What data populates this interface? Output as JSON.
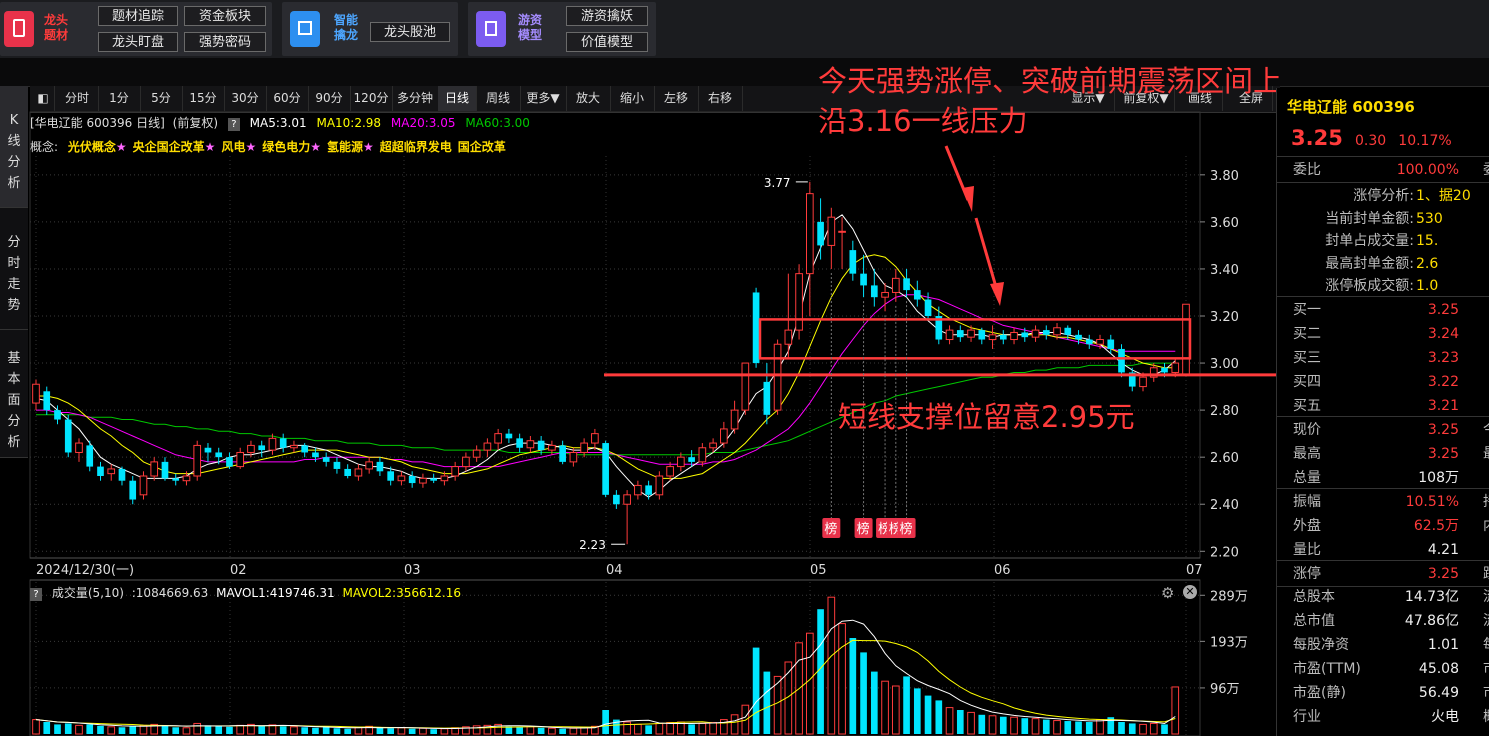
{
  "topbar": {
    "group1_title": "龙头题材",
    "group1_buttons": [
      "题材追踪",
      "资金板块",
      "龙头盯盘",
      "强势密码"
    ],
    "group2_title": "智能擒龙",
    "group2_buttons": [
      "龙头股池"
    ],
    "group3_title": "游资模型",
    "group3_buttons": [
      "游资擒妖",
      "价值模型"
    ]
  },
  "left_tabs": [
    "K线分析",
    "分时走势",
    "基本面分析"
  ],
  "toolbar": {
    "items": [
      "分时",
      "1分",
      "5分",
      "15分",
      "30分",
      "60分",
      "90分",
      "120分",
      "多分钟",
      "日线",
      "周线",
      "更多▼",
      "放大",
      "缩小",
      "左移",
      "右移"
    ],
    "active": "日线",
    "right_items": [
      "显示▼",
      "前复权▼",
      "画线",
      "全屏"
    ]
  },
  "chart_header": {
    "title": "[华电辽能 600396 日线]",
    "adjust": "(前复权)",
    "help": "?",
    "ma5": "MA5:3.01",
    "ma10": "MA10:2.98",
    "ma20": "MA20:3.05",
    "ma60": "MA60:3.00",
    "concept_label": "概念:",
    "concepts": [
      "光伏概念★",
      "央企国企改革★",
      "风电★",
      "绿色电力★",
      "氢能源★",
      "超超临界发电",
      "国企改革"
    ]
  },
  "vol_header": {
    "help": "?",
    "label": "成交量(5,10)",
    "value": ":1084669.63",
    "mavol1": "MAVOL1:419746.31",
    "mavol2": "MAVOL2:356612.16"
  },
  "annotations": {
    "top": [
      "今天强势涨停、突破前期震荡区间上",
      "沿3.16一线压力"
    ],
    "bottom": "短线支撑位留意2.95元"
  },
  "colors": {
    "up": "#ff3b3b",
    "down": "#00e5ff",
    "ma5": "#ffffff",
    "ma10": "#ffff00",
    "ma20": "#ff00ff",
    "ma60": "#00c800",
    "annot": "#ff3b3b"
  },
  "chart_data": {
    "type": "candlestick",
    "price_ticks": [
      "3.80",
      "3.60",
      "3.40",
      "3.20",
      "3.00",
      "2.80",
      "2.60",
      "2.40",
      "2.20"
    ],
    "volume_ticks": [
      "289万",
      "193万",
      "96万"
    ],
    "date_labels": [
      "2024/12/30(一)",
      "02",
      "03",
      "04",
      "05",
      "06",
      "07"
    ],
    "high_label": "3.77",
    "low_label": "2.23",
    "bang_labels": [
      "榜",
      "榜",
      "榜",
      "榜",
      "榜"
    ],
    "ylim": [
      2.18,
      3.88
    ],
    "resistance": 3.16,
    "support": 2.95,
    "candles": [
      [
        2.83,
        2.91,
        2.8,
        2.93
      ],
      [
        2.88,
        2.8,
        2.78,
        2.9
      ],
      [
        2.8,
        2.76,
        2.74,
        2.82
      ],
      [
        2.76,
        2.62,
        2.6,
        2.78
      ],
      [
        2.62,
        2.66,
        2.58,
        2.68
      ],
      [
        2.65,
        2.56,
        2.54,
        2.67
      ],
      [
        2.56,
        2.52,
        2.5,
        2.58
      ],
      [
        2.53,
        2.55,
        2.5,
        2.57
      ],
      [
        2.55,
        2.5,
        2.48,
        2.56
      ],
      [
        2.5,
        2.42,
        2.4,
        2.52
      ],
      [
        2.44,
        2.52,
        2.42,
        2.54
      ],
      [
        2.52,
        2.58,
        2.5,
        2.6
      ],
      [
        2.58,
        2.51,
        2.5,
        2.6
      ],
      [
        2.51,
        2.5,
        2.48,
        2.53
      ],
      [
        2.5,
        2.52,
        2.48,
        2.54
      ],
      [
        2.52,
        2.65,
        2.5,
        2.67
      ],
      [
        2.64,
        2.62,
        2.58,
        2.66
      ],
      [
        2.62,
        2.6,
        2.57,
        2.64
      ],
      [
        2.6,
        2.56,
        2.55,
        2.62
      ],
      [
        2.56,
        2.62,
        2.55,
        2.64
      ],
      [
        2.62,
        2.65,
        2.6,
        2.67
      ],
      [
        2.65,
        2.63,
        2.6,
        2.67
      ],
      [
        2.63,
        2.68,
        2.61,
        2.7
      ],
      [
        2.68,
        2.64,
        2.62,
        2.7
      ],
      [
        2.64,
        2.65,
        2.62,
        2.67
      ],
      [
        2.65,
        2.62,
        2.6,
        2.66
      ],
      [
        2.62,
        2.6,
        2.58,
        2.64
      ],
      [
        2.6,
        2.58,
        2.56,
        2.62
      ],
      [
        2.58,
        2.55,
        2.53,
        2.6
      ],
      [
        2.55,
        2.52,
        2.51,
        2.57
      ],
      [
        2.52,
        2.55,
        2.5,
        2.57
      ],
      [
        2.55,
        2.58,
        2.53,
        2.6
      ],
      [
        2.58,
        2.54,
        2.52,
        2.6
      ],
      [
        2.54,
        2.5,
        2.48,
        2.56
      ],
      [
        2.5,
        2.52,
        2.48,
        2.54
      ],
      [
        2.52,
        2.49,
        2.47,
        2.54
      ],
      [
        2.49,
        2.51,
        2.47,
        2.53
      ],
      [
        2.51,
        2.5,
        2.49,
        2.53
      ],
      [
        2.5,
        2.52,
        2.48,
        2.54
      ],
      [
        2.52,
        2.56,
        2.5,
        2.58
      ],
      [
        2.56,
        2.6,
        2.54,
        2.62
      ],
      [
        2.6,
        2.63,
        2.58,
        2.65
      ],
      [
        2.63,
        2.66,
        2.6,
        2.68
      ],
      [
        2.66,
        2.7,
        2.63,
        2.72
      ],
      [
        2.7,
        2.68,
        2.66,
        2.72
      ],
      [
        2.68,
        2.64,
        2.62,
        2.7
      ],
      [
        2.64,
        2.67,
        2.62,
        2.69
      ],
      [
        2.67,
        2.63,
        2.61,
        2.69
      ],
      [
        2.63,
        2.65,
        2.61,
        2.67
      ],
      [
        2.65,
        2.58,
        2.57,
        2.67
      ],
      [
        2.58,
        2.62,
        2.56,
        2.64
      ],
      [
        2.62,
        2.66,
        2.6,
        2.68
      ],
      [
        2.66,
        2.7,
        2.63,
        2.72
      ],
      [
        2.66,
        2.44,
        2.43,
        2.67
      ],
      [
        2.44,
        2.4,
        2.38,
        2.46
      ],
      [
        2.4,
        2.44,
        2.23,
        2.46
      ],
      [
        2.44,
        2.48,
        2.42,
        2.5
      ],
      [
        2.48,
        2.44,
        2.42,
        2.5
      ],
      [
        2.44,
        2.52,
        2.42,
        2.54
      ],
      [
        2.52,
        2.56,
        2.5,
        2.58
      ],
      [
        2.56,
        2.6,
        2.54,
        2.62
      ],
      [
        2.6,
        2.58,
        2.56,
        2.63
      ],
      [
        2.58,
        2.64,
        2.56,
        2.66
      ],
      [
        2.64,
        2.66,
        2.62,
        2.68
      ],
      [
        2.66,
        2.72,
        2.64,
        2.75
      ],
      [
        2.72,
        2.8,
        2.7,
        2.84
      ],
      [
        2.8,
        3.0,
        2.78,
        3.0
      ],
      [
        3.3,
        3.0,
        2.98,
        3.32
      ],
      [
        2.92,
        2.78,
        2.74,
        3.0
      ],
      [
        2.8,
        3.08,
        2.78,
        3.1
      ],
      [
        3.08,
        3.14,
        3.02,
        3.38
      ],
      [
        3.14,
        3.38,
        3.1,
        3.42
      ],
      [
        3.38,
        3.72,
        3.2,
        3.77
      ],
      [
        3.6,
        3.5,
        3.44,
        3.7
      ],
      [
        3.5,
        3.62,
        3.4,
        3.66
      ],
      [
        3.56,
        3.56,
        3.4,
        3.62
      ],
      [
        3.48,
        3.38,
        3.35,
        3.52
      ],
      [
        3.38,
        3.33,
        3.28,
        3.46
      ],
      [
        3.33,
        3.28,
        3.24,
        3.4
      ],
      [
        3.28,
        3.3,
        3.22,
        3.34
      ],
      [
        3.3,
        3.36,
        3.26,
        3.4
      ],
      [
        3.36,
        3.31,
        3.28,
        3.4
      ],
      [
        3.31,
        3.27,
        3.24,
        3.35
      ],
      [
        3.27,
        3.2,
        3.18,
        3.3
      ],
      [
        3.2,
        3.1,
        3.08,
        3.24
      ],
      [
        3.1,
        3.14,
        3.08,
        3.16
      ],
      [
        3.14,
        3.11,
        3.09,
        3.16
      ],
      [
        3.11,
        3.14,
        3.09,
        3.16
      ],
      [
        3.14,
        3.1,
        3.08,
        3.15
      ],
      [
        3.1,
        3.12,
        3.06,
        3.16
      ],
      [
        3.12,
        3.1,
        3.08,
        3.14
      ],
      [
        3.1,
        3.13,
        3.08,
        3.15
      ],
      [
        3.13,
        3.11,
        3.09,
        3.15
      ],
      [
        3.11,
        3.14,
        3.09,
        3.16
      ],
      [
        3.14,
        3.12,
        3.1,
        3.16
      ],
      [
        3.12,
        3.15,
        3.1,
        3.17
      ],
      [
        3.15,
        3.12,
        3.1,
        3.16
      ],
      [
        3.12,
        3.1,
        3.08,
        3.14
      ],
      [
        3.1,
        3.08,
        3.06,
        3.12
      ],
      [
        3.08,
        3.1,
        3.06,
        3.12
      ],
      [
        3.1,
        3.06,
        3.04,
        3.12
      ],
      [
        3.06,
        2.96,
        2.94,
        3.08
      ],
      [
        2.96,
        2.9,
        2.88,
        2.98
      ],
      [
        2.9,
        2.94,
        2.88,
        2.96
      ],
      [
        2.94,
        2.98,
        2.92,
        3.0
      ],
      [
        2.98,
        2.96,
        2.94,
        3.0
      ],
      [
        2.96,
        3.0,
        2.94,
        3.02
      ],
      [
        2.95,
        3.25,
        2.95,
        3.25
      ]
    ],
    "volumes": [
      30,
      25,
      20,
      22,
      18,
      20,
      17,
      15,
      14,
      16,
      18,
      20,
      17,
      14,
      13,
      22,
      18,
      16,
      15,
      18,
      20,
      17,
      19,
      16,
      15,
      14,
      13,
      15,
      12,
      11,
      14,
      16,
      13,
      12,
      13,
      11,
      12,
      10,
      11,
      13,
      15,
      17,
      18,
      20,
      16,
      14,
      15,
      13,
      12,
      11,
      12,
      14,
      16,
      50,
      30,
      25,
      20,
      18,
      22,
      24,
      25,
      20,
      22,
      24,
      30,
      40,
      60,
      180,
      130,
      120,
      150,
      190,
      210,
      260,
      285,
      230,
      200,
      170,
      130,
      110,
      100,
      120,
      95,
      80,
      70,
      55,
      50,
      45,
      40,
      38,
      36,
      35,
      33,
      32,
      30,
      28,
      27,
      26,
      25,
      30,
      35,
      25,
      22,
      20,
      22,
      20,
      98
    ],
    "ma5": [
      2.85,
      2.84,
      2.8,
      2.76,
      2.72,
      2.66,
      2.6,
      2.57,
      2.55,
      2.53,
      2.51,
      2.51,
      2.51,
      2.51,
      2.52,
      2.55,
      2.57,
      2.58,
      2.6,
      2.61,
      2.61,
      2.62,
      2.63,
      2.64,
      2.65,
      2.65,
      2.64,
      2.63,
      2.61,
      2.59,
      2.57,
      2.56,
      2.56,
      2.55,
      2.54,
      2.52,
      2.51,
      2.51,
      2.51,
      2.52,
      2.54,
      2.56,
      2.59,
      2.63,
      2.65,
      2.66,
      2.66,
      2.66,
      2.65,
      2.64,
      2.63,
      2.63,
      2.64,
      2.62,
      2.56,
      2.51,
      2.46,
      2.43,
      2.46,
      2.5,
      2.53,
      2.56,
      2.59,
      2.62,
      2.66,
      2.72,
      2.8,
      2.87,
      2.9,
      2.97,
      3.05,
      3.2,
      3.38,
      3.49,
      3.6,
      3.63,
      3.57,
      3.48,
      3.39,
      3.33,
      3.31,
      3.28,
      3.22,
      3.18,
      3.14,
      3.12,
      3.12,
      3.12,
      3.12,
      3.11,
      3.12,
      3.12,
      3.12,
      3.13,
      3.13,
      3.13,
      3.12,
      3.11,
      3.1,
      3.08,
      3.04,
      3.0,
      2.97,
      2.95,
      2.95,
      2.97,
      3.01
    ],
    "ma10": [
      2.86,
      2.86,
      2.85,
      2.83,
      2.8,
      2.76,
      2.72,
      2.69,
      2.65,
      2.62,
      2.58,
      2.56,
      2.54,
      2.53,
      2.53,
      2.53,
      2.54,
      2.55,
      2.56,
      2.57,
      2.58,
      2.59,
      2.6,
      2.61,
      2.62,
      2.63,
      2.63,
      2.63,
      2.63,
      2.62,
      2.61,
      2.6,
      2.6,
      2.59,
      2.58,
      2.56,
      2.55,
      2.54,
      2.53,
      2.53,
      2.53,
      2.54,
      2.55,
      2.57,
      2.59,
      2.61,
      2.62,
      2.63,
      2.64,
      2.65,
      2.64,
      2.64,
      2.64,
      2.63,
      2.61,
      2.58,
      2.55,
      2.53,
      2.51,
      2.51,
      2.51,
      2.52,
      2.53,
      2.56,
      2.59,
      2.62,
      2.66,
      2.71,
      2.76,
      2.8,
      2.87,
      2.96,
      3.07,
      3.18,
      3.28,
      3.36,
      3.42,
      3.45,
      3.46,
      3.45,
      3.41,
      3.35,
      3.3,
      3.25,
      3.22,
      3.19,
      3.17,
      3.15,
      3.14,
      3.13,
      3.12,
      3.12,
      3.12,
      3.12,
      3.12,
      3.11,
      3.11,
      3.1,
      3.09,
      3.08,
      3.06,
      3.04,
      3.02,
      3.0,
      2.99,
      2.98,
      2.98
    ],
    "ma20": [
      2.8,
      2.8,
      2.79,
      2.79,
      2.78,
      2.77,
      2.75,
      2.73,
      2.71,
      2.69,
      2.67,
      2.65,
      2.63,
      2.61,
      2.6,
      2.59,
      2.58,
      2.58,
      2.58,
      2.58,
      2.58,
      2.58,
      2.58,
      2.58,
      2.58,
      2.59,
      2.59,
      2.6,
      2.6,
      2.6,
      2.6,
      2.6,
      2.6,
      2.59,
      2.59,
      2.58,
      2.58,
      2.57,
      2.56,
      2.56,
      2.56,
      2.56,
      2.56,
      2.56,
      2.57,
      2.58,
      2.59,
      2.6,
      2.61,
      2.62,
      2.62,
      2.62,
      2.62,
      2.62,
      2.61,
      2.6,
      2.59,
      2.58,
      2.57,
      2.57,
      2.57,
      2.57,
      2.57,
      2.58,
      2.58,
      2.59,
      2.61,
      2.63,
      2.66,
      2.69,
      2.72,
      2.77,
      2.83,
      2.9,
      2.97,
      3.04,
      3.1,
      3.16,
      3.21,
      3.25,
      3.28,
      3.29,
      3.29,
      3.28,
      3.27,
      3.25,
      3.23,
      3.21,
      3.19,
      3.18,
      3.16,
      3.15,
      3.14,
      3.13,
      3.12,
      3.11,
      3.1,
      3.09,
      3.08,
      3.07,
      3.06,
      3.05,
      3.05,
      3.05,
      3.05,
      3.05,
      3.05
    ],
    "ma60": [
      2.78,
      2.78,
      2.78,
      2.78,
      2.78,
      2.77,
      2.77,
      2.77,
      2.76,
      2.76,
      2.75,
      2.74,
      2.74,
      2.73,
      2.73,
      2.72,
      2.72,
      2.71,
      2.71,
      2.7,
      2.7,
      2.69,
      2.69,
      2.68,
      2.68,
      2.68,
      2.67,
      2.67,
      2.67,
      2.66,
      2.66,
      2.66,
      2.65,
      2.65,
      2.65,
      2.64,
      2.64,
      2.64,
      2.63,
      2.63,
      2.63,
      2.63,
      2.63,
      2.63,
      2.62,
      2.62,
      2.62,
      2.62,
      2.62,
      2.62,
      2.61,
      2.61,
      2.61,
      2.61,
      2.61,
      2.61,
      2.61,
      2.61,
      2.61,
      2.61,
      2.61,
      2.61,
      2.61,
      2.62,
      2.62,
      2.62,
      2.63,
      2.64,
      2.65,
      2.66,
      2.67,
      2.69,
      2.71,
      2.73,
      2.75,
      2.77,
      2.79,
      2.81,
      2.83,
      2.84,
      2.86,
      2.87,
      2.88,
      2.89,
      2.9,
      2.91,
      2.92,
      2.93,
      2.94,
      2.94,
      2.95,
      2.96,
      2.96,
      2.97,
      2.97,
      2.98,
      2.98,
      2.98,
      2.99,
      2.99,
      2.99,
      2.99,
      2.99,
      3.0,
      3.0,
      3.0,
      3.0
    ]
  },
  "right_panel": {
    "stock_name": "华电辽能",
    "stock_code": "600396",
    "price": "3.25",
    "change": "0.30",
    "pct": "10.17%",
    "weibi_label": "委比",
    "weibi_value": "100.00%",
    "weibi_cut": "委",
    "limit_rows": [
      {
        "label": "涨停分析:",
        "value": "1、据20"
      },
      {
        "label": "当前封单金额:",
        "value": "530"
      },
      {
        "label": "封单占成交量:",
        "value": "15."
      },
      {
        "label": "最高封单金额:",
        "value": "2.6"
      },
      {
        "label": "涨停板成交额:",
        "value": "1.0"
      }
    ],
    "order_book": [
      {
        "label": "买一",
        "value": "3.25"
      },
      {
        "label": "买二",
        "value": "3.24"
      },
      {
        "label": "买三",
        "value": "3.23"
      },
      {
        "label": "买四",
        "value": "3.22"
      },
      {
        "label": "买五",
        "value": "3.21"
      }
    ],
    "quote_rows": [
      {
        "label": "现价",
        "value": "3.25",
        "color": "red",
        "cut": "今"
      },
      {
        "label": "最高",
        "value": "3.25",
        "color": "red",
        "cut": "最"
      },
      {
        "label": "总量",
        "value": "108万",
        "color": "white",
        "cut": ""
      }
    ],
    "stat_rows": [
      {
        "label": "振幅",
        "value": "10.51%",
        "color": "red",
        "cut": "持"
      },
      {
        "label": "外盘",
        "value": "62.5万",
        "color": "red",
        "cut": "内"
      },
      {
        "label": "量比",
        "value": "4.21",
        "color": "white",
        "cut": ""
      }
    ],
    "limit_row": {
      "label": "涨停",
      "value": "3.25",
      "color": "red",
      "cut": "跌"
    },
    "fund_rows": [
      {
        "label": "总股本",
        "value": "14.73亿",
        "color": "white",
        "cut": "流"
      },
      {
        "label": "总市值",
        "value": "47.86亿",
        "color": "white",
        "cut": "流"
      },
      {
        "label": "每股净资",
        "value": "1.01",
        "color": "white",
        "cut": "每"
      },
      {
        "label": "市盈(TTM)",
        "value": "45.08",
        "color": "white",
        "cut": "市"
      },
      {
        "label": "市盈(静)",
        "value": "56.49",
        "color": "white",
        "cut": "市"
      },
      {
        "label": "行业",
        "value": "火电",
        "color": "white",
        "cut": "概"
      }
    ]
  }
}
